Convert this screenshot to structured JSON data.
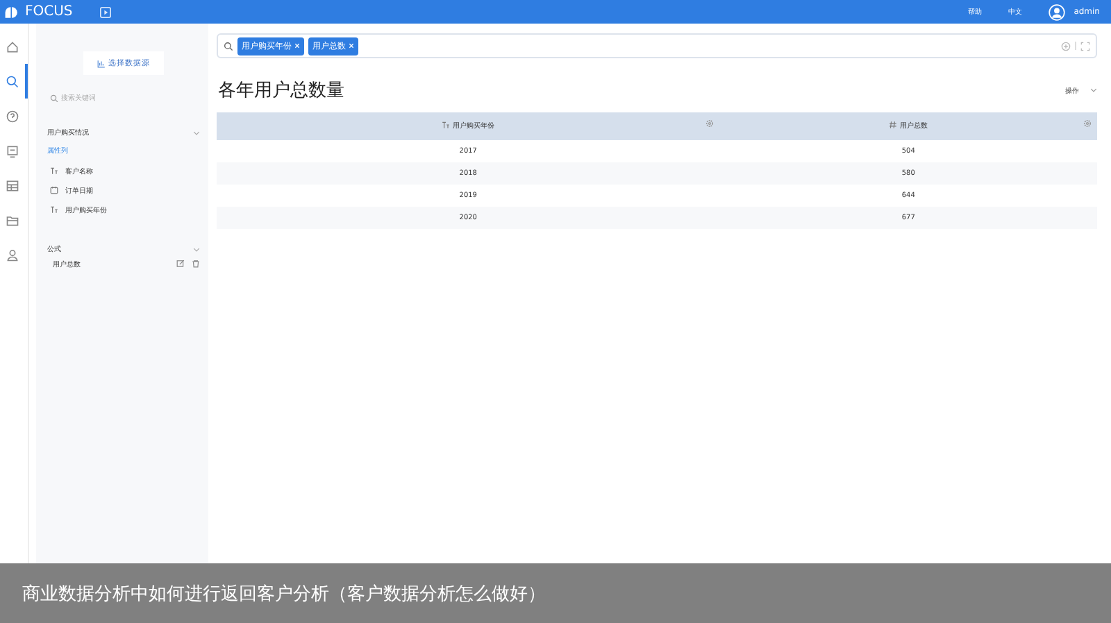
{
  "topbar": {
    "logo": "FOCUS",
    "links": [
      "帮助",
      "中文"
    ],
    "user": "admin"
  },
  "nav": [
    {
      "kind": "home",
      "selected": false
    },
    {
      "kind": "search",
      "selected": true
    },
    {
      "kind": "help",
      "selected": false
    },
    {
      "kind": "board",
      "selected": false
    },
    {
      "kind": "table",
      "selected": false
    },
    {
      "kind": "folder",
      "selected": false
    },
    {
      "kind": "user",
      "selected": false
    }
  ],
  "sidebar": {
    "source_button": "选择数据源",
    "search_placeholder": "搜索关键词",
    "groups": [
      {
        "title": "用户购买情况",
        "expanded": true,
        "subtitle": "属性列",
        "items": [
          {
            "kind": "text",
            "label": "客户名称"
          },
          {
            "kind": "date",
            "label": "订单日期"
          },
          {
            "kind": "text",
            "label": "用户购买年份"
          }
        ]
      },
      {
        "title": "公式",
        "expanded": true,
        "items": [
          {
            "kind": "formula",
            "label": "用户总数"
          }
        ]
      }
    ]
  },
  "search_bar": {
    "tokens": [
      "用户购买年份",
      "用户总数"
    ]
  },
  "title": "各年用户总数量",
  "actions": "操作",
  "table": {
    "columns": [
      {
        "kind": "text",
        "label": "用户购买年份"
      },
      {
        "kind": "number",
        "label": "用户总数"
      }
    ],
    "rows": [
      [
        "2017",
        "504"
      ],
      [
        "2018",
        "580"
      ],
      [
        "2019",
        "644"
      ],
      [
        "2020",
        "677"
      ]
    ]
  },
  "caption": "商业数据分析中如何进行返回客户分析（客户数据分析怎么做好）"
}
